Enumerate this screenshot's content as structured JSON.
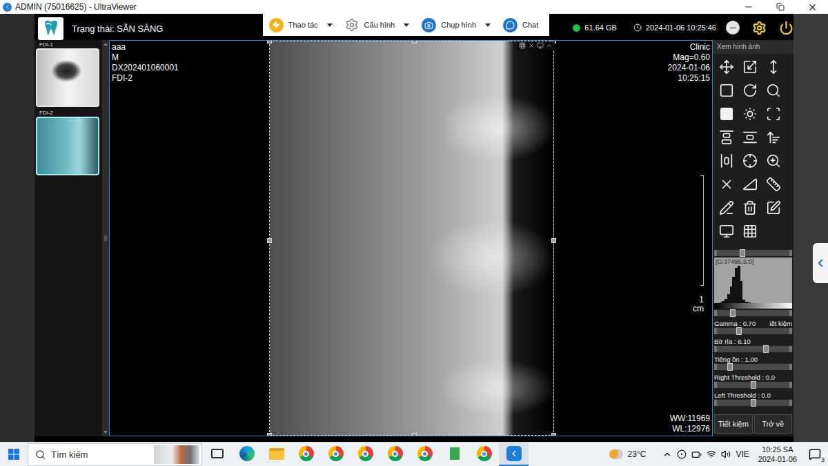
{
  "window": {
    "title": "ADMIN (75016625) - UltraViewer"
  },
  "app_header": {
    "status": "Trạng thái: SẴN SÀNG",
    "menus": [
      {
        "label": "Thao tác",
        "has_dropdown": true
      },
      {
        "label": "Cấu hình",
        "has_dropdown": true
      },
      {
        "label": "Chụp hình",
        "has_dropdown": true
      },
      {
        "label": "Chat",
        "has_dropdown": false
      }
    ],
    "storage": "61.64 GB",
    "datetime": "2024-01-06 10:25:46"
  },
  "thumbnails": [
    {
      "label": "FDI-1",
      "selected": false
    },
    {
      "label": "FDI-2",
      "selected": true
    }
  ],
  "viewer": {
    "info_left": [
      "aaa",
      "M",
      "DX202401060001",
      "FDI-2"
    ],
    "info_right": [
      "Clinic",
      "Mag=0.60",
      "2024-01-06",
      "10:25:15"
    ],
    "scale": {
      "value": "1",
      "unit": "cm"
    },
    "window_level": [
      "WW:11969",
      "WL:12976"
    ]
  },
  "tools_panel": {
    "title": "Xem hình ảnh",
    "histogram": {
      "label": "[G:37496,S:0]",
      "top_level": 0.35,
      "bottom_level": 0.22,
      "bins": [
        0,
        0,
        2,
        5,
        12,
        25,
        45,
        70,
        95,
        100,
        60,
        10,
        3,
        1,
        0,
        0,
        0,
        0,
        0,
        0,
        0,
        0,
        0,
        0,
        0,
        0,
        0,
        0,
        0,
        0
      ]
    },
    "sliders": [
      {
        "label": "Gamma : 0.70",
        "extra": "iết kiệm",
        "level": 0.3
      },
      {
        "label": "Bờ rìa : 6.10",
        "level": 0.68
      },
      {
        "label": "Tiếng ồn : 1.00",
        "level": 0.18
      },
      {
        "label": "Right Threshold : 0.0",
        "level": 0.5
      },
      {
        "label": "Left Threshold : 0.0",
        "level": 0.5
      }
    ],
    "buttons": [
      "Tiết kiệm",
      "Trở về"
    ]
  },
  "taskbar": {
    "search_placeholder": "Tìm kiếm",
    "apps": [
      {
        "kind": "taskview",
        "active": false
      },
      {
        "kind": "edge",
        "active": false
      },
      {
        "kind": "folder",
        "active": false
      },
      {
        "kind": "chrome",
        "active": false
      },
      {
        "kind": "chrome",
        "active": false
      },
      {
        "kind": "chrome",
        "active": false
      },
      {
        "kind": "chrome",
        "active": false
      },
      {
        "kind": "chrome",
        "active": false
      },
      {
        "kind": "sheet",
        "active": false
      },
      {
        "kind": "chrome",
        "active": false
      },
      {
        "kind": "ultraviewer",
        "active": true
      }
    ],
    "weather": "23°C",
    "language": "VIE",
    "time": "10:25 SA",
    "date": "2024-01-06",
    "notifications": "3"
  }
}
